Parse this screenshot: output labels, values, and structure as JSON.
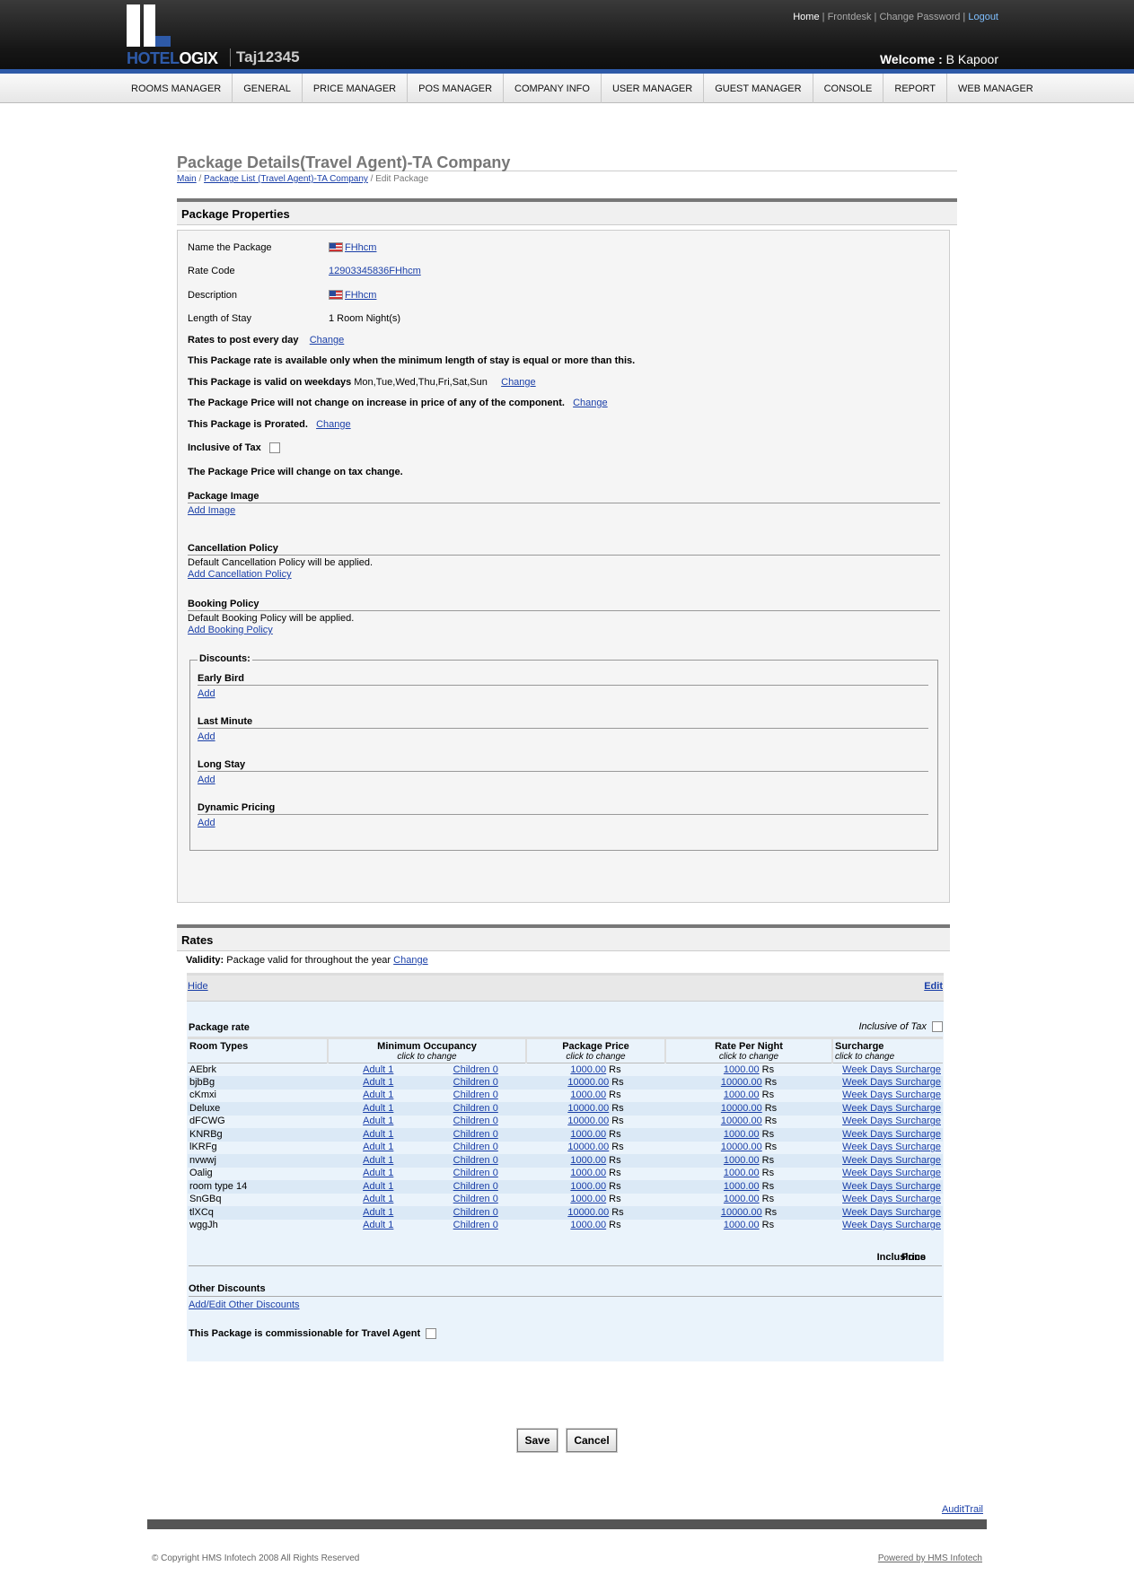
{
  "header": {
    "logo": {
      "part1": "HOTEL",
      "part2": "OGIX"
    },
    "hotel_name": "Taj12345",
    "links": {
      "home": "Home",
      "frontdesk": "Frontdesk",
      "change_password": "Change Password",
      "logout": "Logout",
      "sep": "|"
    },
    "welcome_label": "Welcome :",
    "user": "B Kapoor"
  },
  "nav": [
    "ROOMS MANAGER",
    "GENERAL",
    "PRICE MANAGER",
    "POS MANAGER",
    "COMPANY INFO",
    "USER MANAGER",
    "GUEST MANAGER",
    "CONSOLE",
    "REPORT",
    "WEB MANAGER"
  ],
  "page": {
    "title": "Package Details(Travel Agent)-TA Company",
    "breadcrumb": {
      "main": "Main",
      "sep": "/",
      "list": "Package List (Travel Agent)-TA Company",
      "current": "/ Edit Package"
    }
  },
  "properties": {
    "heading": "Package Properties",
    "name_label": "Name the Package",
    "name_value": "FHhcm",
    "rate_code_label": "Rate Code",
    "rate_code_value": "12903345836FHhcm",
    "description_label": "Description",
    "description_value": "FHhcm",
    "length_label": "Length of Stay",
    "length_value": "1 Room Night(s)",
    "rates_post": "Rates to post every day",
    "change": "Change",
    "min_stay_text": "This Package rate is available only when the minimum length of stay is equal or more than this.",
    "weekdays_text": "This Package is valid on weekdays",
    "weekdays_value": "Mon,Tue,Wed,Thu,Fri,Sat,Sun",
    "price_text": "The Package Price will not change on increase in price of any of the component.",
    "prorated_text": "This Package is Prorated.",
    "inclusive_tax": "Inclusive of Tax",
    "tax_change": "The Package Price will change on tax change.",
    "image_heading": "Package Image",
    "add_image": "Add Image",
    "cancel_heading": "Cancellation Policy",
    "cancel_default": "Default Cancellation Policy will be applied.",
    "add_cancel": "Add Cancellation Policy",
    "booking_heading": "Booking Policy",
    "booking_default": "Default Booking Policy will be applied.",
    "add_booking": "Add Booking Policy",
    "discounts_legend": "Discounts:",
    "discounts": [
      {
        "name": "Early Bird",
        "link": "Add"
      },
      {
        "name": "Last Minute",
        "link": "Add"
      },
      {
        "name": "Long Stay",
        "link": "Add"
      },
      {
        "name": "Dynamic Pricing",
        "link": "Add"
      }
    ]
  },
  "rates": {
    "heading": "Rates",
    "validity_label": "Validity:",
    "validity_value": "Package valid for throughout the year",
    "change": "Change",
    "hide": "Hide",
    "edit": "Edit",
    "package_rate": "Package rate",
    "inclusive_tax": "Inclusive of Tax",
    "columns": {
      "room_types": "Room Types",
      "min_occ": "Minimum Occupancy",
      "pkg_price": "Package Price",
      "rate_night": "Rate Per Night",
      "surcharge": "Surcharge",
      "click": "click to change"
    },
    "currency": "Rs",
    "rows": [
      {
        "room": "AEbrk",
        "adult": "Adult 1",
        "children": "Children 0",
        "price": "1000.00",
        "rate": "1000.00",
        "surcharge": "Week Days Surcharge"
      },
      {
        "room": "bjbBg",
        "adult": "Adult 1",
        "children": "Children 0",
        "price": "10000.00",
        "rate": "10000.00",
        "surcharge": "Week Days Surcharge"
      },
      {
        "room": "cKmxi",
        "adult": "Adult 1",
        "children": "Children 0",
        "price": "1000.00",
        "rate": "1000.00",
        "surcharge": "Week Days Surcharge"
      },
      {
        "room": "Deluxe",
        "adult": "Adult 1",
        "children": "Children 0",
        "price": "10000.00",
        "rate": "10000.00",
        "surcharge": "Week Days Surcharge"
      },
      {
        "room": "dFCWG",
        "adult": "Adult 1",
        "children": "Children 0",
        "price": "10000.00",
        "rate": "10000.00",
        "surcharge": "Week Days Surcharge"
      },
      {
        "room": "KNRBg",
        "adult": "Adult 1",
        "children": "Children 0",
        "price": "1000.00",
        "rate": "1000.00",
        "surcharge": "Week Days Surcharge"
      },
      {
        "room": "lKRFg",
        "adult": "Adult 1",
        "children": "Children 0",
        "price": "10000.00",
        "rate": "10000.00",
        "surcharge": "Week Days Surcharge"
      },
      {
        "room": "nvwwj",
        "adult": "Adult 1",
        "children": "Children 0",
        "price": "1000.00",
        "rate": "1000.00",
        "surcharge": "Week Days Surcharge"
      },
      {
        "room": "Oalig",
        "adult": "Adult 1",
        "children": "Children 0",
        "price": "1000.00",
        "rate": "1000.00",
        "surcharge": "Week Days Surcharge"
      },
      {
        "room": "room type 14",
        "adult": "Adult 1",
        "children": "Children 0",
        "price": "1000.00",
        "rate": "1000.00",
        "surcharge": "Week Days Surcharge"
      },
      {
        "room": "SnGBq",
        "adult": "Adult 1",
        "children": "Children 0",
        "price": "1000.00",
        "rate": "1000.00",
        "surcharge": "Week Days Surcharge"
      },
      {
        "room": "tlXCq",
        "adult": "Adult 1",
        "children": "Children 0",
        "price": "10000.00",
        "rate": "10000.00",
        "surcharge": "Week Days Surcharge"
      },
      {
        "room": "wggJh",
        "adult": "Adult 1",
        "children": "Children 0",
        "price": "1000.00",
        "rate": "1000.00",
        "surcharge": "Week Days Surcharge"
      }
    ],
    "inclusions": "Inclusions",
    "price": "Price",
    "other_discounts": "Other Discounts",
    "add_edit_discounts": "Add/Edit Other Discounts",
    "commissionable": "This Package is commissionable for Travel Agent"
  },
  "buttons": {
    "save": "Save",
    "cancel": "Cancel"
  },
  "footer": {
    "audit": "AuditTrail",
    "copyright": "© Copyright HMS Infotech 2008 All Rights Reserved",
    "powered": "Powered by HMS Infotech"
  }
}
